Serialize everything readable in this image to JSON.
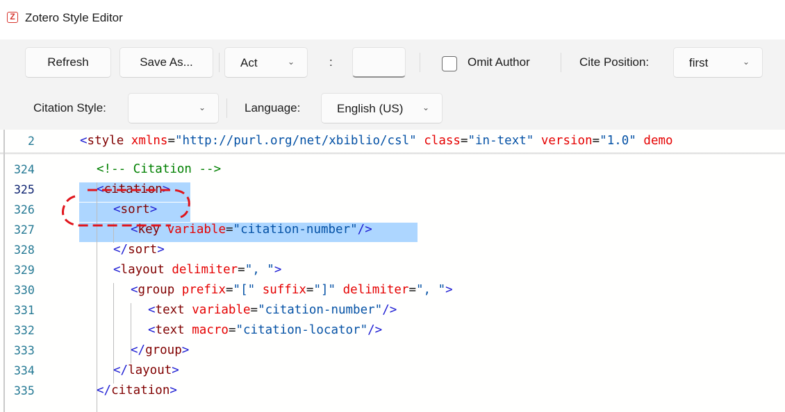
{
  "window": {
    "title": "Zotero Style Editor",
    "app_icon_letter": "Z"
  },
  "toolbar": {
    "refresh_label": "Refresh",
    "save_as_label": "Save As...",
    "locator_select_value": "Act",
    "colon": ":",
    "locator_value": "",
    "omit_author_label": "Omit Author",
    "omit_author_checked": false,
    "cite_position_label": "Cite Position:",
    "cite_position_value": "first",
    "citation_style_label": "Citation Style:",
    "citation_style_value": "",
    "language_label": "Language:",
    "language_value": "English (US)"
  },
  "editor": {
    "sticky_line": {
      "number": "2",
      "text": "<style xmlns=\"http://purl.org/net/xbiblio/csl\" class=\"in-text\" version=\"1.0\" demo"
    },
    "lines": [
      {
        "number": "324",
        "text": "<!-- Citation -->"
      },
      {
        "number": "325",
        "text": "<citation>"
      },
      {
        "number": "326",
        "text": "<sort>"
      },
      {
        "number": "327",
        "text": "<key variable=\"citation-number\"/>"
      },
      {
        "number": "328",
        "text": "</sort>"
      },
      {
        "number": "329",
        "text": "<layout delimiter=\", \">"
      },
      {
        "number": "330",
        "text": "<group prefix=\"[\" suffix=\"]\" delimiter=\", \">"
      },
      {
        "number": "331",
        "text": "<text variable=\"citation-number\"/>"
      },
      {
        "number": "332",
        "text": "<text macro=\"citation-locator\"/>"
      },
      {
        "number": "333",
        "text": "</group>"
      },
      {
        "number": "334",
        "text": "</layout>"
      },
      {
        "number": "335",
        "text": "</citation>"
      }
    ],
    "colors": {
      "selection": "#add6ff",
      "annotation": "#e0141b",
      "line_number": "#237893",
      "tag": "#800000",
      "attribute": "#e50000",
      "string": "#0451a5",
      "comment": "#008000"
    }
  }
}
